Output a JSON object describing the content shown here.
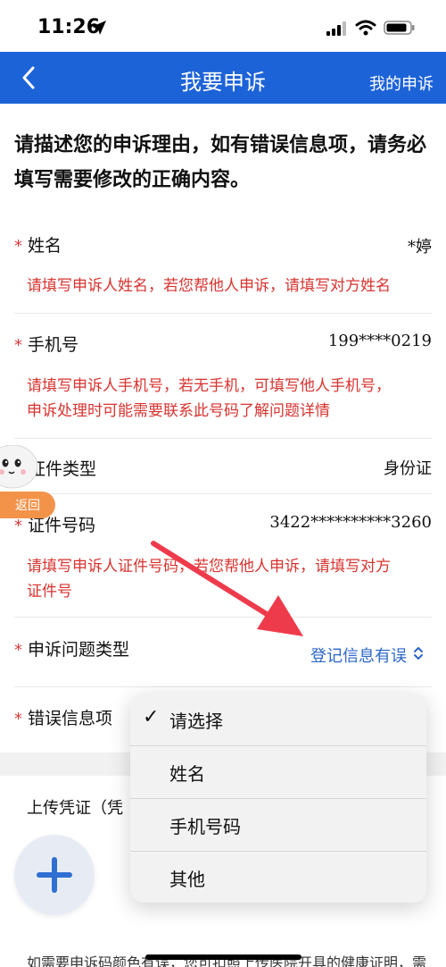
{
  "status_bar": {
    "time": "11:26"
  },
  "navbar": {
    "title": "我要申诉",
    "right_link": "我的申诉"
  },
  "intro": "请描述您的申诉理由，如有错误信息项，请务必填写需要修改的正确内容。",
  "form": {
    "required_mark": "*",
    "name": {
      "label": "姓名",
      "value": "*婷",
      "hint": "请填写申诉人姓名，若您帮他人申诉，请填写对方姓名"
    },
    "phone": {
      "label": "手机号",
      "value": "199****0219",
      "hint_line1": "请填写申诉人手机号，若无手机，可填写他人手机号，",
      "hint_line2": "申诉处理时可能需要联系此号码了解问题详情"
    },
    "id_type": {
      "label": "证件类型",
      "value": "身份证"
    },
    "id_number": {
      "label": "证件号码",
      "value": "3422**********3260",
      "hint_line1": "请填写申诉人证件号码，若您帮他人申诉，请填写对方",
      "hint_line2": "证件号"
    },
    "issue_type": {
      "label": "申诉问题类型",
      "value": "登记信息有误"
    },
    "error_item": {
      "label": "错误信息项"
    },
    "upload": {
      "label": "上传凭证（凭"
    },
    "bottom_note": "如需要申诉码颜色有误，您可扣照上传医院开具的健康证明，需"
  },
  "float_widget": {
    "back_label": "返回"
  },
  "dropdown": {
    "options": [
      "请选择",
      "姓名",
      "手机号码",
      "其他"
    ],
    "selected_index": 0,
    "check_mark": "✓"
  },
  "colors": {
    "brand": "#1d63d8",
    "hint_red": "#d8332f",
    "link_blue": "#2b67c8",
    "arrow": "#ee3b4b"
  }
}
